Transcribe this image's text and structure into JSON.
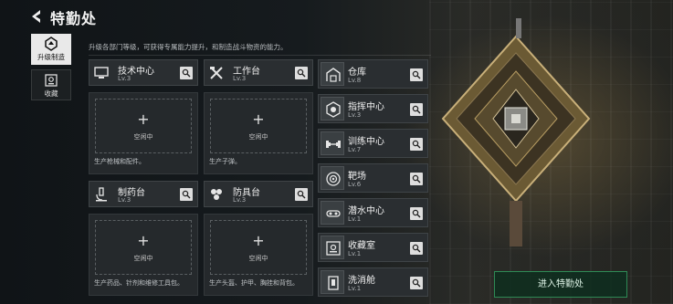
{
  "header": {
    "title": "特勤处",
    "description": "升级各部门等级，可获得专属能力提升，和制造战斗物资的能力。"
  },
  "tabs": [
    {
      "label": "升级制造",
      "icon": "upgrade-icon",
      "active": true
    },
    {
      "label": "收藏",
      "icon": "collection-icon",
      "active": false
    }
  ],
  "large_cards": [
    {
      "name": "技术中心",
      "level": "Lv.3",
      "icon": "monitor-icon",
      "slot_text": "空闲中",
      "note": "生产枪械和配件。"
    },
    {
      "name": "工作台",
      "level": "Lv.3",
      "icon": "tools-icon",
      "slot_text": "空闲中",
      "note": "生产子弹。"
    },
    {
      "name": "制药台",
      "level": "Lv.3",
      "icon": "microscope-icon",
      "slot_text": "空闲中",
      "note": "生产药品、针剂和维修工具包。"
    },
    {
      "name": "防具台",
      "level": "Lv.3",
      "icon": "armor-icon",
      "slot_text": "空闲中",
      "note": "生产头盔、护甲、胸挂和背包。"
    }
  ],
  "side_list": [
    {
      "name": "仓库",
      "level": "Lv.8",
      "icon": "warehouse-icon"
    },
    {
      "name": "指挥中心",
      "level": "Lv.3",
      "icon": "command-icon"
    },
    {
      "name": "训练中心",
      "level": "Lv.7",
      "icon": "dumbbell-icon"
    },
    {
      "name": "靶场",
      "level": "Lv.6",
      "icon": "target-icon"
    },
    {
      "name": "潜水中心",
      "level": "Lv.1",
      "icon": "diving-icon"
    },
    {
      "name": "收藏室",
      "level": "Lv.1",
      "icon": "collection-room-icon"
    },
    {
      "name": "洗消舱",
      "level": "Lv.1",
      "icon": "decon-icon"
    }
  ],
  "enter_button": {
    "label": "进入特勤处"
  },
  "colors": {
    "accent_green": "#2e8a55",
    "panel": "#2a2e31"
  }
}
